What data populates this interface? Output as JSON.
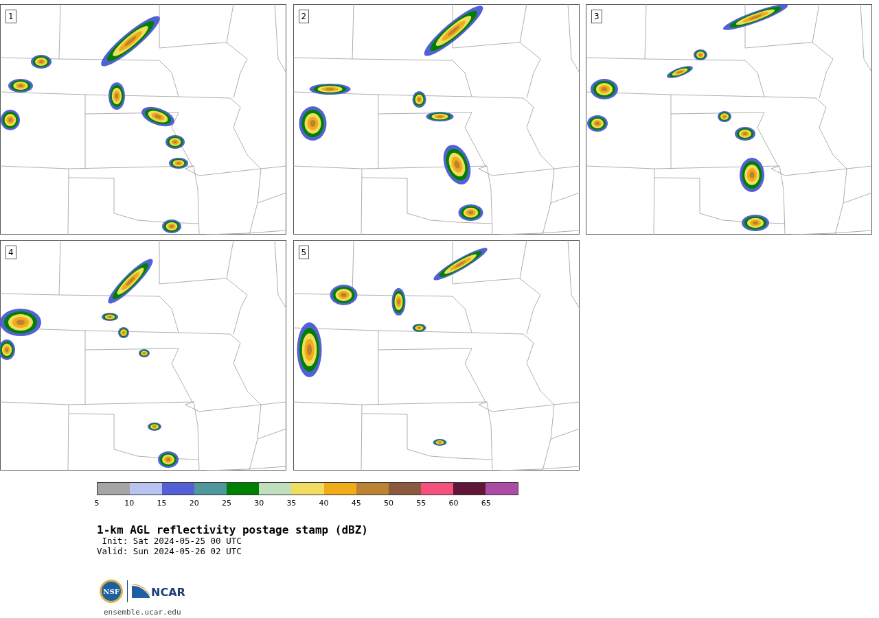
{
  "panels": [
    {
      "label": "1"
    },
    {
      "label": "2"
    },
    {
      "label": "3"
    },
    {
      "label": "4"
    },
    {
      "label": "5"
    }
  ],
  "colorbar": {
    "bins": [
      {
        "color": "#a5a5a5"
      },
      {
        "color": "#b9c3ef"
      },
      {
        "color": "#5360d6"
      },
      {
        "color": "#50979e"
      },
      {
        "color": "#008000"
      },
      {
        "color": "#bfdfbf"
      },
      {
        "color": "#f0dc60"
      },
      {
        "color": "#f0ac18"
      },
      {
        "color": "#ba8232"
      },
      {
        "color": "#8b5a3e"
      },
      {
        "color": "#f5517f"
      },
      {
        "color": "#611737"
      },
      {
        "color": "#ac4ca5"
      }
    ],
    "ticks": [
      "5",
      "10",
      "15",
      "20",
      "25",
      "30",
      "35",
      "40",
      "45",
      "50",
      "55",
      "60",
      "65"
    ]
  },
  "title": "1-km AGL reflectivity postage stamp (dBZ)",
  "init": " Init: Sat 2024-05-25 00 UTC",
  "valid": "Valid: Sun 2024-05-26 02 UTC",
  "logo": {
    "nsf": "NSF",
    "ncar": "NCAR"
  },
  "url": "ensemble.ucar.edu"
}
